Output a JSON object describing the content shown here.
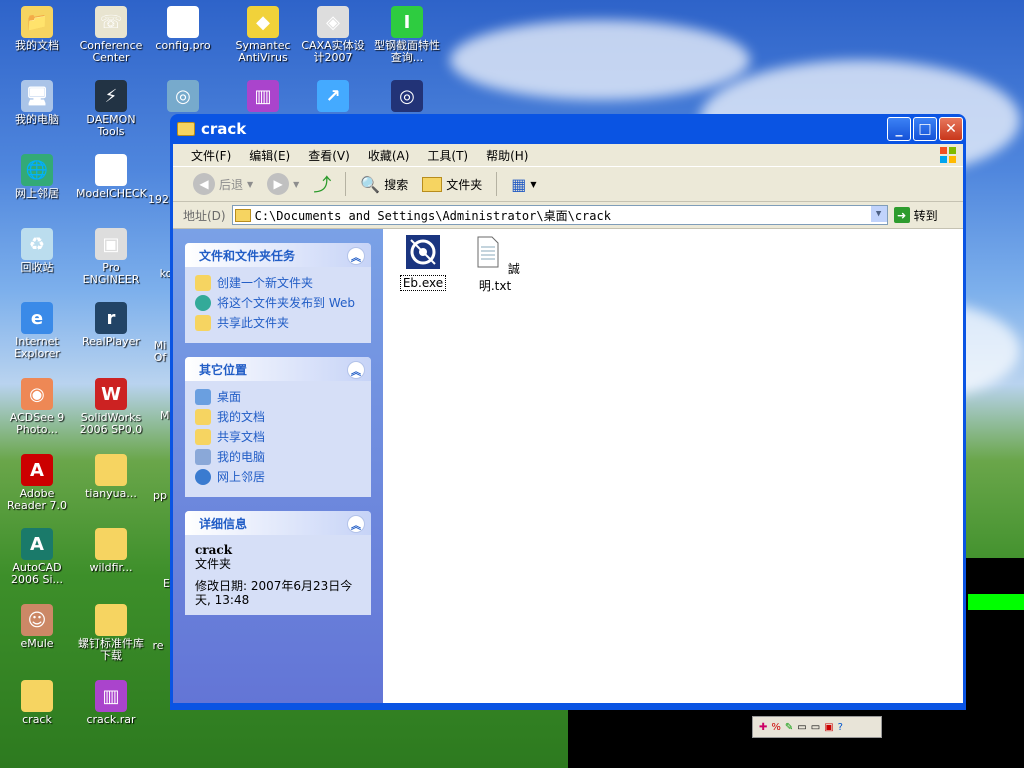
{
  "desktop": {
    "icons": [
      {
        "label": "我的文档",
        "color": "#f6d461",
        "glyph": "📁"
      },
      {
        "label": "Conference Center",
        "color": "#e8e4d0",
        "glyph": "☏"
      },
      {
        "label": "config.pro",
        "color": "#fff",
        "glyph": "◧"
      },
      {
        "label": "Symantec AntiVirus",
        "color": "#f1d23a",
        "glyph": "◆"
      },
      {
        "label": "CAXA实体设计2007",
        "color": "#ddd",
        "glyph": "◈"
      },
      {
        "label": "型钢截面特性查询...",
        "color": "#2ecc40",
        "glyph": "I"
      },
      {
        "label": "我的电脑",
        "color": "#aac4e8",
        "glyph": "🖥"
      },
      {
        "label": "DAEMON Tools",
        "color": "#234",
        "glyph": "⚡"
      },
      {
        "label": "fe",
        "color": "#7ac",
        "glyph": "◎"
      },
      {
        "label": "",
        "color": "#a4c",
        "glyph": "▥"
      },
      {
        "label": "",
        "color": "#4af",
        "glyph": "↗"
      },
      {
        "label": "",
        "color": "#237",
        "glyph": "◎"
      },
      {
        "label": "网上邻居",
        "color": "#3a7",
        "glyph": "🌐"
      },
      {
        "label": "ModelCHECK",
        "color": "#fff",
        "glyph": "✔"
      },
      {
        "label": "回收站",
        "color": "#bde",
        "glyph": "♻"
      },
      {
        "label": "Pro ENGINEER",
        "color": "#ddd",
        "glyph": "▣"
      },
      {
        "label": "Internet Explorer",
        "color": "#3a8ae8",
        "glyph": "e"
      },
      {
        "label": "RealPlayer",
        "color": "#246",
        "glyph": "r"
      },
      {
        "label": "ACDSee 9 Photo...",
        "color": "#e85",
        "glyph": "◉"
      },
      {
        "label": "SolidWorks 2006 SP0.0",
        "color": "#c22",
        "glyph": "W"
      },
      {
        "label": "Adobe Reader 7.0",
        "color": "#c00",
        "glyph": "A"
      },
      {
        "label": "tianyua...",
        "color": "#f6d461",
        "glyph": ""
      },
      {
        "label": "AutoCAD 2006 Si...",
        "color": "#1a7a6a",
        "glyph": "A"
      },
      {
        "label": "wildfir...",
        "color": "#f6d461",
        "glyph": ""
      },
      {
        "label": "eMule",
        "color": "#c86",
        "glyph": "☺"
      },
      {
        "label": "螺钉标准件库下载",
        "color": "#f6d461",
        "glyph": ""
      },
      {
        "label": "crack",
        "color": "#f6d461",
        "glyph": ""
      },
      {
        "label": "crack.rar",
        "color": "#a4c",
        "glyph": "▥"
      }
    ],
    "partial_labels": [
      "192",
      "ko",
      "Mi Of",
      "M 0",
      "pp",
      "El",
      "re"
    ]
  },
  "window": {
    "title": "crack",
    "menu": [
      "文件(F)",
      "编辑(E)",
      "查看(V)",
      "收藏(A)",
      "工具(T)",
      "帮助(H)"
    ],
    "toolbar": {
      "back": "后退",
      "search": "搜索",
      "folders": "文件夹"
    },
    "address": {
      "label": "地址(D)",
      "path": "C:\\Documents and Settings\\Administrator\\桌面\\crack",
      "go": "转到"
    },
    "tasks": {
      "title": "文件和文件夹任务",
      "items": [
        "创建一个新文件夹",
        "将这个文件夹发布到 Web",
        "共享此文件夹"
      ]
    },
    "places": {
      "title": "其它位置",
      "items": [
        "桌面",
        "我的文档",
        "共享文档",
        "我的电脑",
        "网上邻居"
      ]
    },
    "details": {
      "title": "详细信息",
      "name": "crack",
      "type": "文件夹",
      "modified": "修改日期: 2007年6月23日今天, 13:48"
    },
    "files": [
      {
        "name": "Eb.exe"
      },
      {
        "name": "誠明.txt"
      }
    ]
  }
}
